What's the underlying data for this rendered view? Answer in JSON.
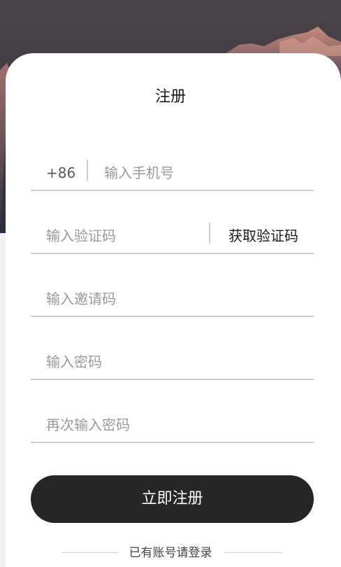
{
  "page": {
    "title": "注册"
  },
  "form": {
    "phone": {
      "prefix": "+86",
      "placeholder": "输入手机号"
    },
    "code": {
      "placeholder": "输入验证码",
      "get_code_label": "获取验证码"
    },
    "invite": {
      "placeholder": "输入邀请码"
    },
    "password": {
      "placeholder": "输入密码"
    },
    "password_confirm": {
      "placeholder": "再次输入密码"
    }
  },
  "submit_label": "立即注册",
  "footer": {
    "login_link": "已有账号请登录"
  },
  "colors": {
    "button": "#262626",
    "divider": "#cfcfcf",
    "placeholder": "#9a9a9a"
  }
}
